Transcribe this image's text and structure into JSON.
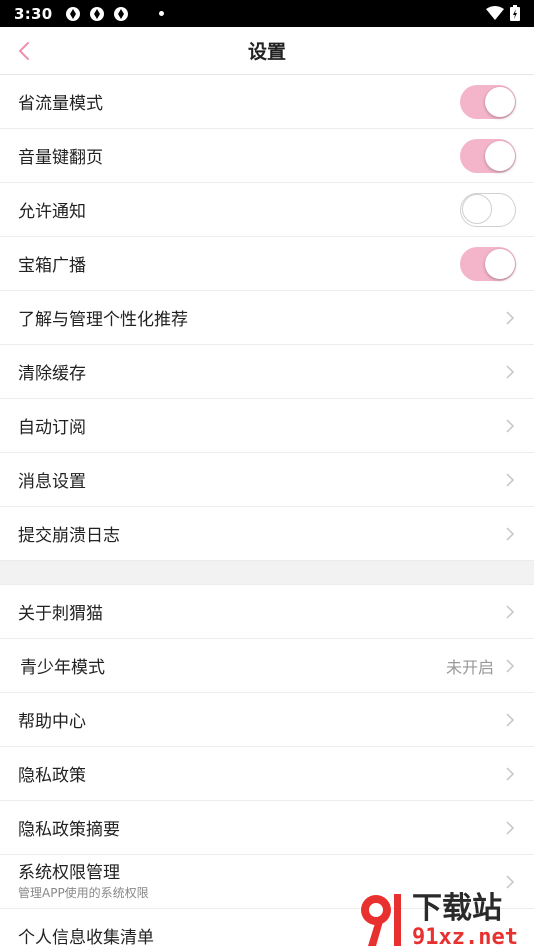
{
  "status": {
    "time": "3:30"
  },
  "header": {
    "title": "设置"
  },
  "toggles": [
    {
      "label": "省流量模式",
      "on": true
    },
    {
      "label": "音量键翻页",
      "on": true
    },
    {
      "label": "允许通知",
      "on": false
    },
    {
      "label": "宝箱广播",
      "on": true
    }
  ],
  "group1": [
    {
      "label": "了解与管理个性化推荐"
    },
    {
      "label": "清除缓存"
    },
    {
      "label": "自动订阅"
    },
    {
      "label": "消息设置"
    },
    {
      "label": "提交崩溃日志"
    }
  ],
  "group2": [
    {
      "label": "关于刺猬猫"
    },
    {
      "label": "青少年模式",
      "value": "未开启"
    },
    {
      "label": "帮助中心"
    },
    {
      "label": "隐私政策"
    },
    {
      "label": "隐私政策摘要"
    }
  ],
  "permission": {
    "label": "系统权限管理",
    "desc": "管理APP使用的系统权限"
  },
  "last": {
    "label": "个人信息收集清单"
  },
  "watermark": {
    "site": "下载站",
    "domain": "91xz.net"
  },
  "colors": {
    "accent": "#f4b5cb",
    "back": "#f090b0"
  }
}
